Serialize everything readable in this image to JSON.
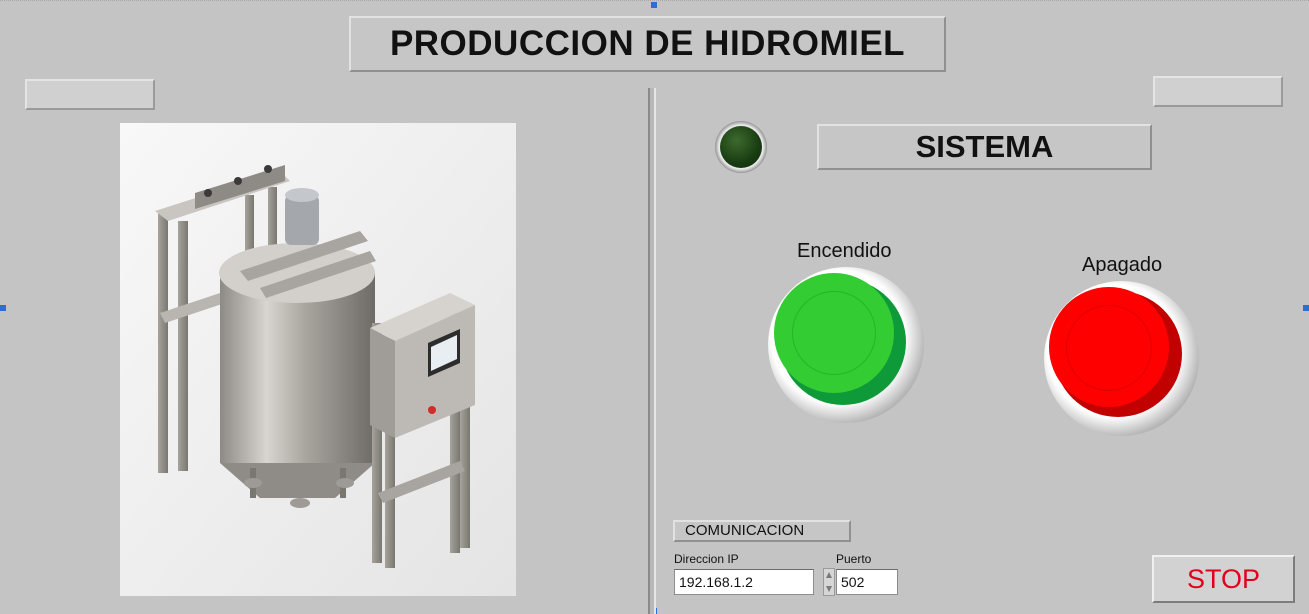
{
  "header": {
    "title": "PRODUCCION DE HIDROMIEL"
  },
  "system": {
    "label": "SISTEMA",
    "led_state": "off",
    "led_color": "#1f4a15"
  },
  "buttons": {
    "on": {
      "label": "Encendido",
      "color": "#33cc33"
    },
    "off": {
      "label": "Apagado",
      "color": "#ff0000"
    },
    "stop": {
      "label": "STOP",
      "color": "#e3001b"
    }
  },
  "communication": {
    "title": "COMUNICACION",
    "ip_label": "Direccion IP",
    "ip_value": "192.168.1.2",
    "port_label": "Puerto",
    "port_value": "502"
  },
  "image": {
    "icon": "mead-production-tank-image"
  }
}
